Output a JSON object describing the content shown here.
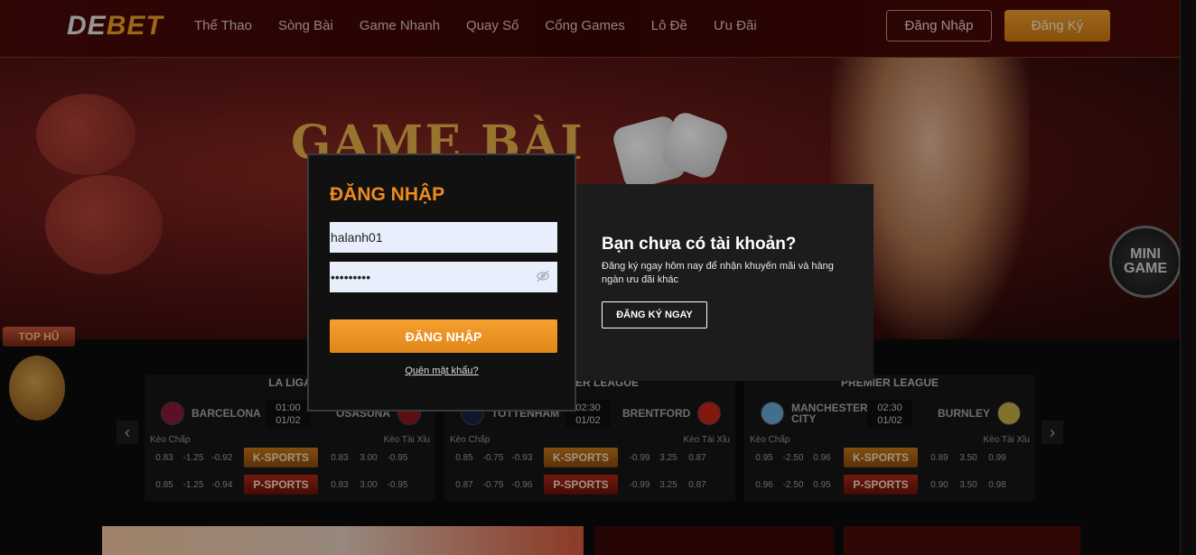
{
  "header": {
    "logo": {
      "part1": "DE",
      "part2": "BET"
    },
    "nav": [
      "Thể Thao",
      "Sòng Bài",
      "Game Nhanh",
      "Quay Số",
      "Cổng Games",
      "Lô Đề",
      "Ưu Đãi"
    ],
    "login_label": "Đăng Nhập",
    "register_label": "Đăng Ký"
  },
  "banner": {
    "title": "GAME BÀI",
    "mini_game": "MINI GAME",
    "top_hu": "TOP HŨ"
  },
  "matches": [
    {
      "league": "LA LIGA",
      "home": "BARCELONA",
      "away": "OSASUNA",
      "time": "01:00",
      "date": "01/02",
      "keo_chap": "Kèo Chấp",
      "keo_tai_xiu": "Kèo Tài Xỉu",
      "rows": [
        {
          "left": [
            "0.83",
            "-1.25",
            "-0.92"
          ],
          "sport": "K-SPORTS",
          "right": [
            "0.83",
            "3.00",
            "-0.95"
          ]
        },
        {
          "left": [
            "0.85",
            "-1.25",
            "-0.94"
          ],
          "sport": "P-SPORTS",
          "right": [
            "0.83",
            "3.00",
            "-0.95"
          ]
        }
      ]
    },
    {
      "league": "PREMIER LEAGUE",
      "home": "TOTTENHAM",
      "away": "BRENTFORD",
      "time": "02:30",
      "date": "01/02",
      "keo_chap": "Kèo Chấp",
      "keo_tai_xiu": "Kèo Tài Xỉu",
      "rows": [
        {
          "left": [
            "0.85",
            "-0.75",
            "-0.93"
          ],
          "sport": "K-SPORTS",
          "right": [
            "-0.99",
            "3.25",
            "0.87"
          ]
        },
        {
          "left": [
            "0.87",
            "-0.75",
            "-0.96"
          ],
          "sport": "P-SPORTS",
          "right": [
            "-0.99",
            "3.25",
            "0.87"
          ]
        }
      ]
    },
    {
      "league": "PREMIER LEAGUE",
      "home": "MANCHESTER CITY",
      "away": "BURNLEY",
      "time": "02:30",
      "date": "01/02",
      "keo_chap": "Kèo Chấp",
      "keo_tai_xiu": "Kèo Tài Xỉu",
      "rows": [
        {
          "left": [
            "0.95",
            "-2.50",
            "0.96"
          ],
          "sport": "K-SPORTS",
          "right": [
            "0.89",
            "3.50",
            "0.99"
          ]
        },
        {
          "left": [
            "0.96",
            "-2.50",
            "0.95"
          ],
          "sport": "P-SPORTS",
          "right": [
            "0.90",
            "3.50",
            "0.98"
          ]
        }
      ]
    }
  ],
  "login_modal": {
    "title": "ĐĂNG NHẬP",
    "username_value": "halanh01",
    "password_value": "•••••••••",
    "submit_label": "ĐĂNG NHẬP",
    "forgot_label": "Quên mật khẩu?"
  },
  "register_panel": {
    "title": "Bạn chưa có tài khoản?",
    "description": "Đăng ký ngay hôm nay để nhận khuyến mãi và hàng ngàn ưu đãi khác",
    "button_label": "ĐĂNG KÝ NGAY"
  },
  "colors": {
    "accent": "#f08a1c",
    "header_bg": "#4a0a08",
    "input_bg": "#e8eefc"
  }
}
